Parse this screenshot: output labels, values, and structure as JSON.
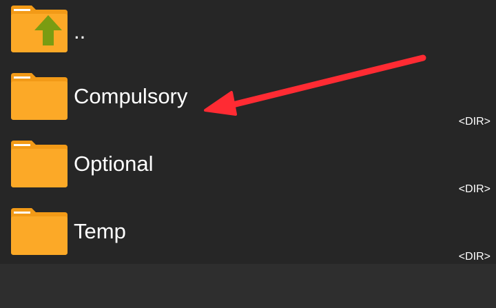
{
  "colors": {
    "folder_body": "#fca927",
    "folder_back": "#f29a17",
    "folder_tab_stripe": "#ffffff",
    "up_arrow": "#7a9c12",
    "annotation_arrow": "#ff2b33",
    "background": "#262626"
  },
  "list": {
    "items": [
      {
        "name": "..",
        "icon": "folder-up-icon",
        "tag": ""
      },
      {
        "name": "Compulsory",
        "icon": "folder-icon",
        "tag": "<DIR>"
      },
      {
        "name": "Optional",
        "icon": "folder-icon",
        "tag": "<DIR>"
      },
      {
        "name": "Temp",
        "icon": "folder-icon",
        "tag": "<DIR>"
      }
    ]
  }
}
